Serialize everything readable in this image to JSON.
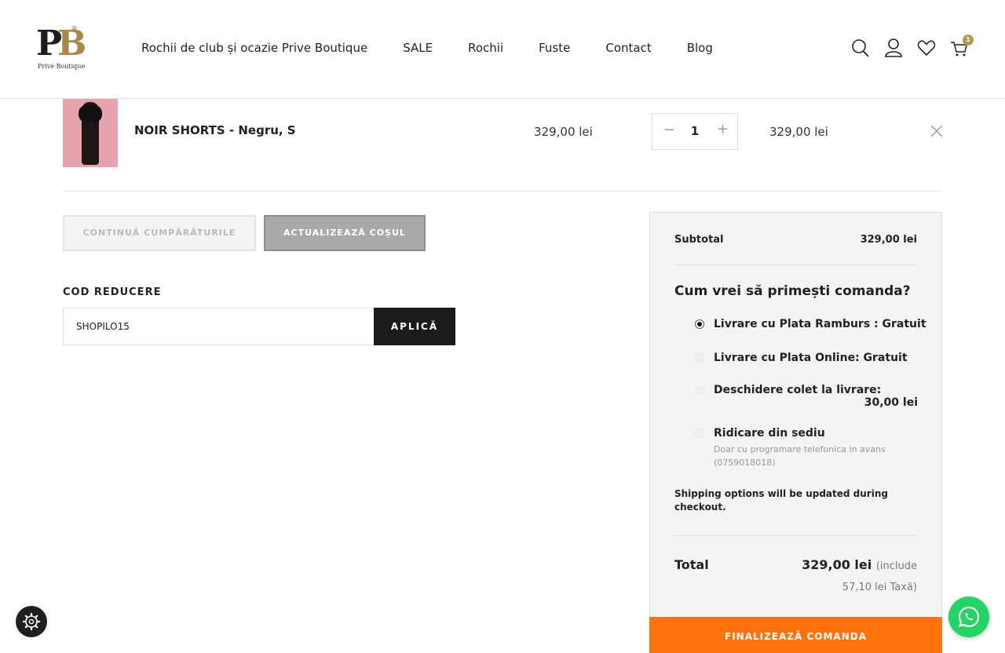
{
  "header": {
    "logo_mark_p": "P",
    "logo_mark_b": "B",
    "logo_sub": "Privé Boutique",
    "nav": [
      "Rochii de club și ocazie Prive Boutique",
      "SALE",
      "Rochii",
      "Fuste",
      "Contact",
      "Blog"
    ],
    "cart_count": "1",
    "icons": [
      "search-icon",
      "user-icon",
      "heart-icon",
      "cart-icon"
    ]
  },
  "cart": {
    "item": {
      "name": "NOIR SHORTS - Negru, S",
      "price": "329,00 lei",
      "quantity": "1",
      "subtotal": "329,00 lei"
    }
  },
  "actions": {
    "continue_label": "CONTINUĂ CUMPĂRĂTURILE",
    "update_label": "ACTUALIZEAZĂ COȘUL"
  },
  "coupon": {
    "title": "COD REDUCERE",
    "value": "SHOPILO15",
    "apply_label": "APLICĂ"
  },
  "totals": {
    "subtotal_label": "Subtotal",
    "subtotal_value": "329,00 lei",
    "shipping_title": "Cum vrei să primești comanda?",
    "options": [
      {
        "label": "Livrare cu Plata Ramburs : Gratuit",
        "selected": true
      },
      {
        "label": "Livrare cu Plata Online: Gratuit",
        "selected": false
      },
      {
        "label": "Deschidere colet la livrare:",
        "price": "30,00 lei",
        "selected": false
      },
      {
        "label": "Ridicare din sediu",
        "note": "Doar cu programare telefonica in avans (0759018018)",
        "selected": false
      }
    ],
    "shipping_note": "Shipping options will be updated during checkout.",
    "total_label": "Total",
    "total_value": "329,00 lei",
    "total_include": "(include",
    "total_tax": "57,10 lei Taxă)",
    "checkout_label": "FINALIZEAZĂ COMANDA"
  },
  "colors": {
    "accent_gold": "#b59a55",
    "checkout_orange": "#ff720c",
    "whatsapp_green": "#25d366"
  }
}
